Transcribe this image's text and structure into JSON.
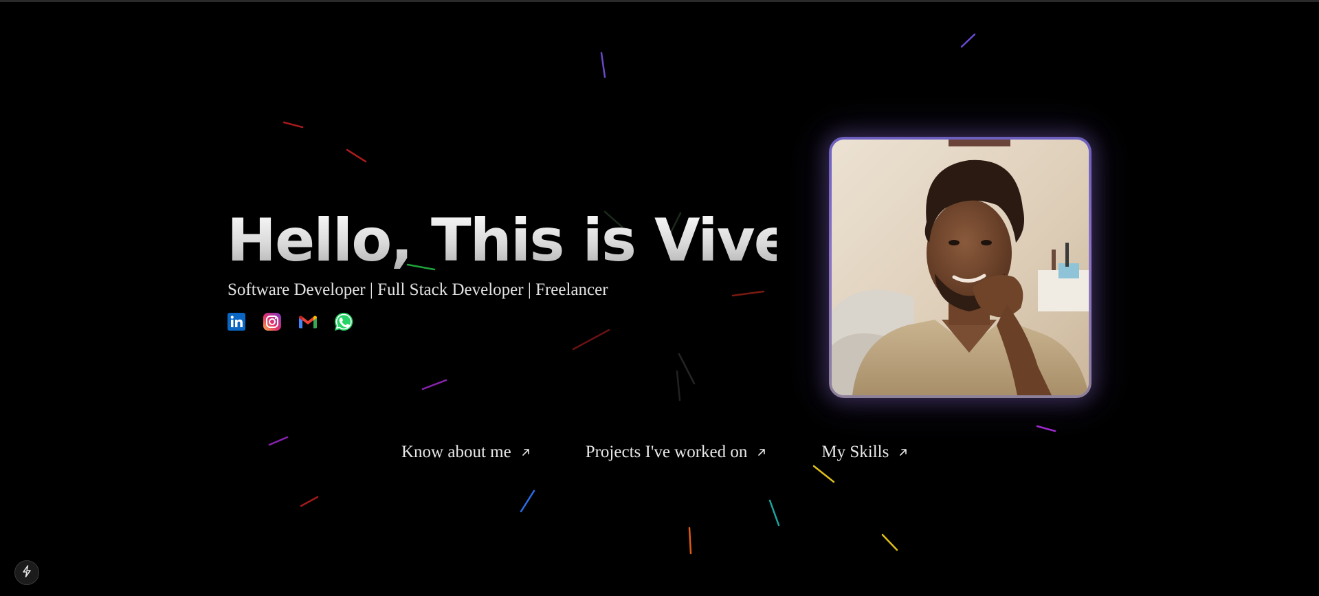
{
  "hero": {
    "title": "Hello, This is Vivek.",
    "subtitle": "Software Developer | Full Stack Developer | Freelancer"
  },
  "socials": [
    {
      "name": "linkedin-icon",
      "color": "#0a66c2"
    },
    {
      "name": "instagram-icon",
      "color": "#e1306c"
    },
    {
      "name": "gmail-icon",
      "color": "#ea4335"
    },
    {
      "name": "whatsapp-icon",
      "color": "#25d366"
    }
  ],
  "nav": {
    "about_label": "Know about me",
    "projects_label": "Projects I've worked on",
    "skills_label": "My Skills",
    "arrow_icon": "arrow-up-right-icon"
  },
  "colors": {
    "background": "#000000",
    "text": "#e8e8e8",
    "portrait_border": "#7a68c4",
    "portrait_glow": "#9678dc"
  },
  "floating_button": {
    "icon": "lightning-bolt-icon"
  }
}
